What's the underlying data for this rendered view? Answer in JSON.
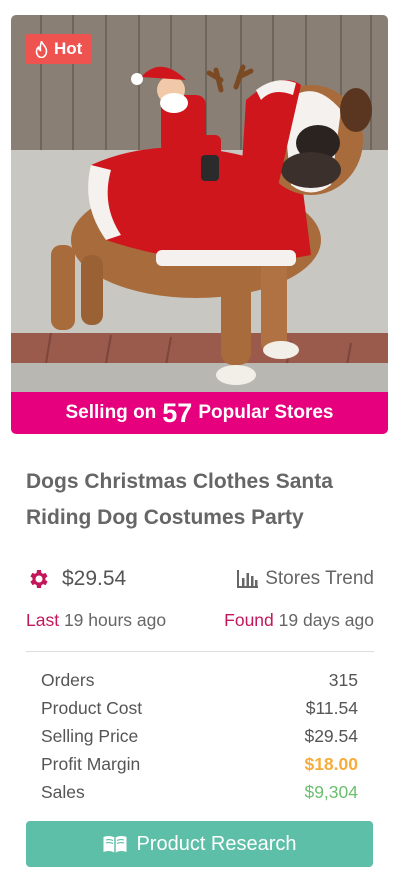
{
  "product": {
    "badge": "Hot",
    "selling_prefix": "Selling on",
    "store_count": "57",
    "selling_suffix": "Popular Stores",
    "title": "Dogs Christmas Clothes Santa Riding Dog Costumes Party",
    "price": "$29.54",
    "trend_label": "Stores Trend",
    "last_label": "Last",
    "last_value": "19 hours ago",
    "found_label": "Found",
    "found_value": "19 days ago",
    "research_label": "Product Research"
  },
  "stats": [
    {
      "label": "Orders",
      "value": "315"
    },
    {
      "label": "Product Cost",
      "value": "$11.54"
    },
    {
      "label": "Selling Price",
      "value": "$29.54"
    },
    {
      "label": "Profit Margin",
      "value": "$18.00"
    },
    {
      "label": "Sales",
      "value": "$9,304"
    }
  ],
  "colors": {
    "hot_badge": "#ef5350",
    "selling_bar": "#e6007e",
    "accent": "#c2185b",
    "profit": "#f6ad3c",
    "sales": "#6cbf6f",
    "button": "#5dbfa8"
  },
  "icons": [
    "fire-icon",
    "gear-icon",
    "bar-chart-icon",
    "book-icon"
  ]
}
